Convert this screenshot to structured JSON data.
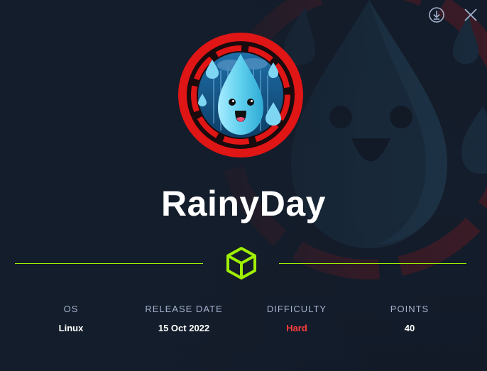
{
  "machine": {
    "name": "RainyDay",
    "avatar_icon": "raindrop-mascot-icon",
    "os_icon": "box-icon"
  },
  "actions": {
    "download_icon": "download-icon",
    "close_icon": "close-icon"
  },
  "stats": [
    {
      "label": "OS",
      "value": "Linux"
    },
    {
      "label": "RELEASE DATE",
      "value": "15 Oct 2022"
    },
    {
      "label": "DIFFICULTY",
      "value": "Hard"
    },
    {
      "label": "POINTS",
      "value": "40"
    }
  ],
  "colors": {
    "background": "#141d2b",
    "accent": "#9fef00",
    "difficulty_hard": "#ff3e3e",
    "ring": "#e01515",
    "label": "#a4b1cd"
  }
}
